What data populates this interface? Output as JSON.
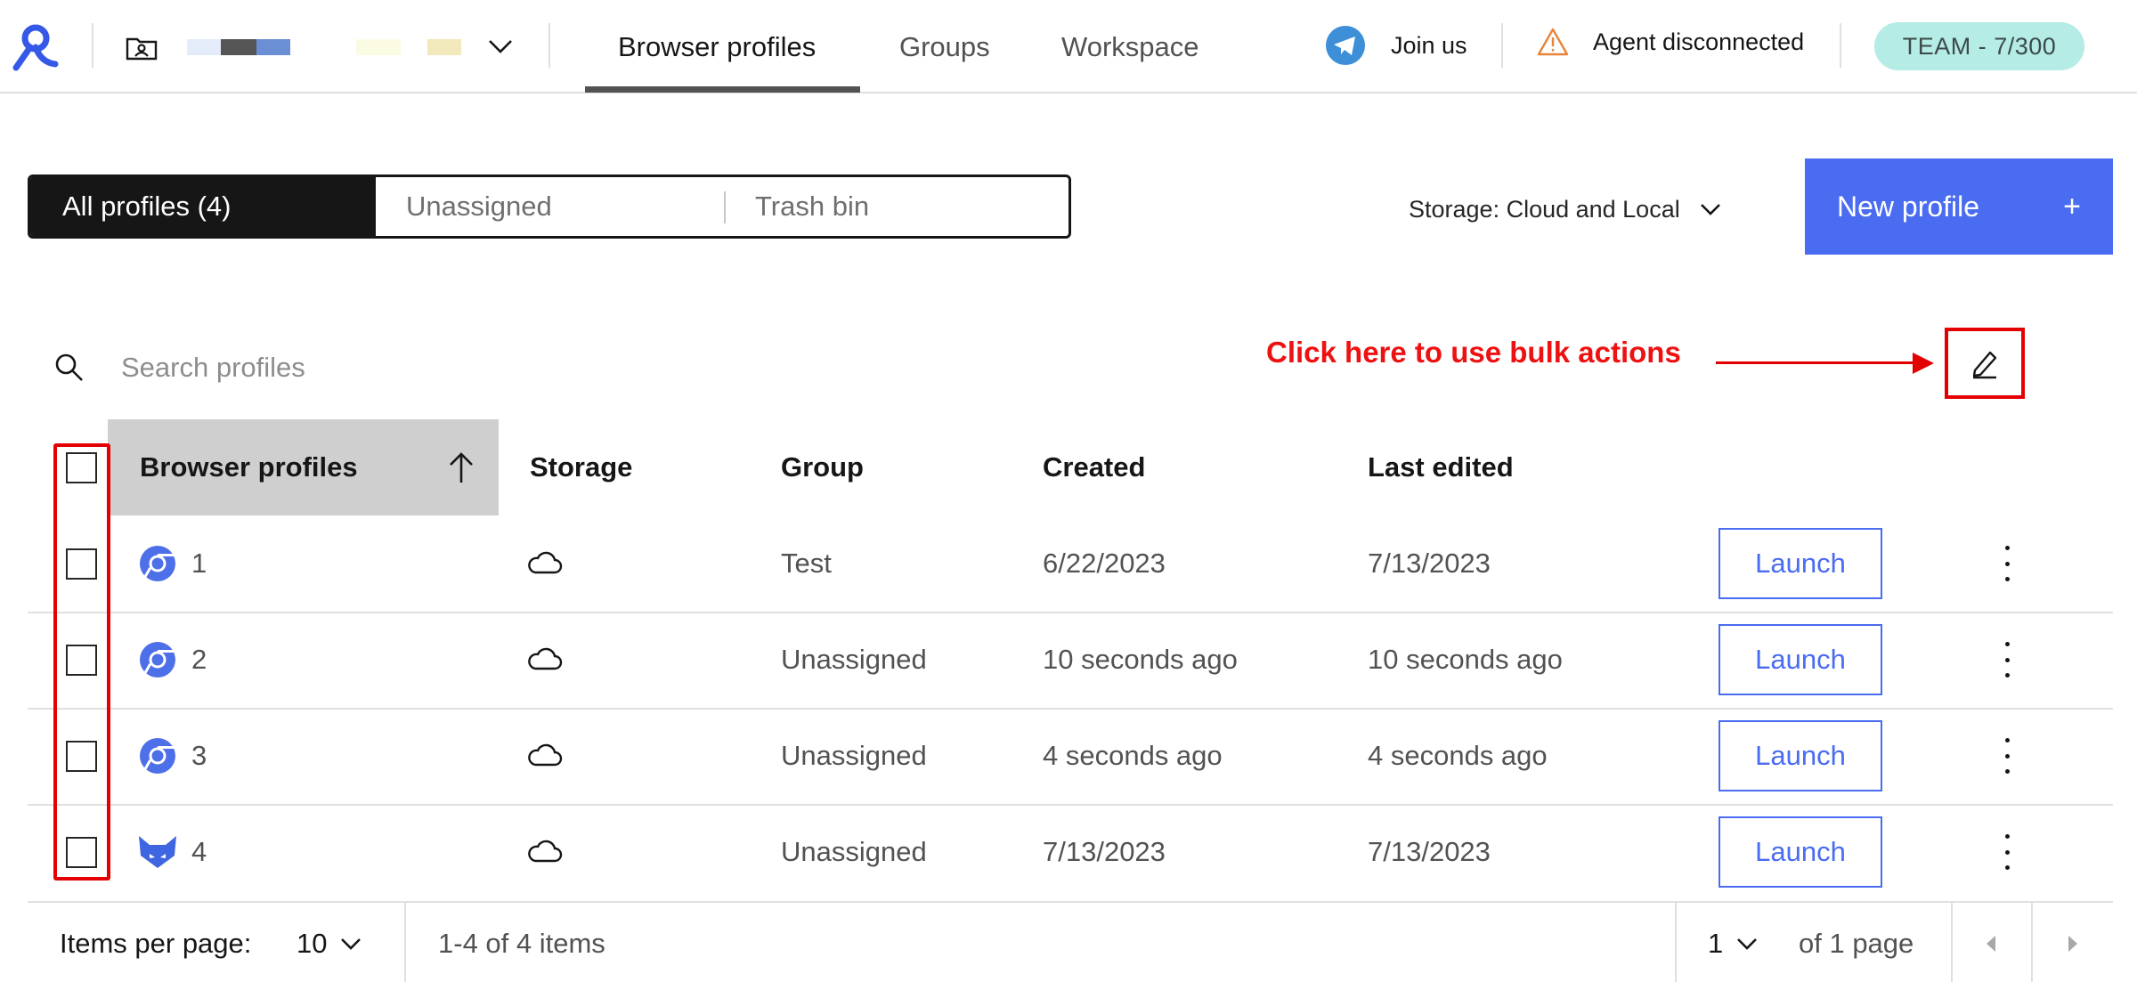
{
  "topbar": {
    "workspace_label": "",
    "nav_tabs": [
      {
        "label": "Browser profiles",
        "active": true
      },
      {
        "label": "Groups",
        "active": false
      },
      {
        "label": "Workspace",
        "active": false
      }
    ],
    "join_label": "Join us",
    "agent_status": "Agent disconnected",
    "team_badge": "TEAM - 7/300"
  },
  "filters": {
    "tabs": [
      {
        "label": "All profiles (4)",
        "active": true
      },
      {
        "label": "Unassigned",
        "active": false
      },
      {
        "label": "Trash bin",
        "active": false
      }
    ],
    "storage_label": "Storage: Cloud and Local",
    "new_profile_label": "New profile",
    "new_profile_icon": "+"
  },
  "search": {
    "placeholder": "Search profiles"
  },
  "annotation": {
    "text": "Click here to use bulk actions",
    "color": "#e30000"
  },
  "table": {
    "columns": [
      "Browser profiles",
      "Storage",
      "Group",
      "Created",
      "Last edited"
    ],
    "rows": [
      {
        "name": "1",
        "browser_icon": "chrome-icon",
        "storage_icon": "cloud-icon",
        "group": "Test",
        "created": "6/22/2023",
        "last_edited": "7/13/2023",
        "action": "Launch"
      },
      {
        "name": "2",
        "browser_icon": "chrome-icon",
        "storage_icon": "cloud-icon",
        "group": "Unassigned",
        "created": "10 seconds ago",
        "last_edited": "10 seconds ago",
        "action": "Launch"
      },
      {
        "name": "3",
        "browser_icon": "chrome-icon",
        "storage_icon": "cloud-icon",
        "group": "Unassigned",
        "created": "4 seconds ago",
        "last_edited": "4 seconds ago",
        "action": "Launch"
      },
      {
        "name": "4",
        "browser_icon": "fox-icon",
        "storage_icon": "cloud-icon",
        "group": "Unassigned",
        "created": "7/13/2023",
        "last_edited": "7/13/2023",
        "action": "Launch"
      }
    ]
  },
  "pagination": {
    "items_per_page_label": "Items per page:",
    "items_per_page": "10",
    "range": "1-4 of 4 items",
    "page": "1",
    "of_pages": "of 1 page"
  },
  "colors": {
    "accent": "#4a6cf0",
    "team_badge_bg": "#b5ece6",
    "annotation_red": "#e40000"
  }
}
